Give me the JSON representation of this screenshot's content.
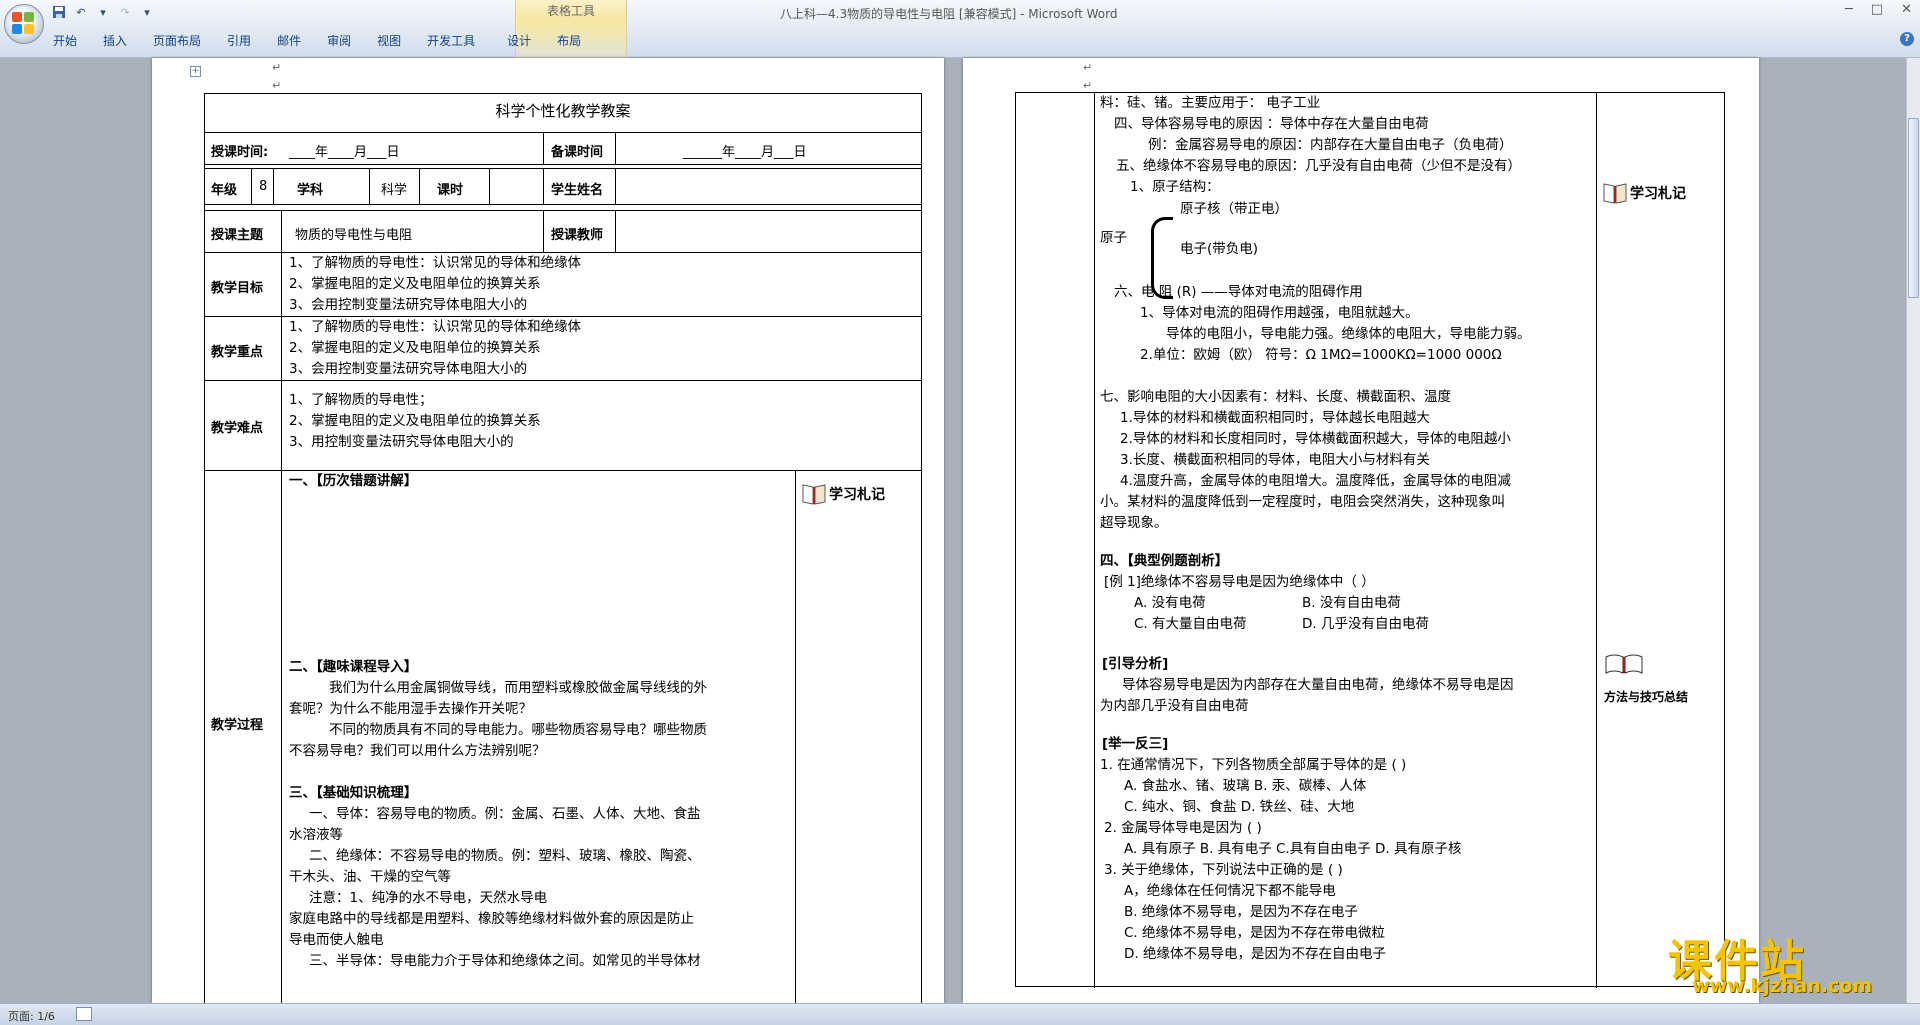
{
  "window": {
    "title": "八上科—4.3物质的导电性与电阻 [兼容模式] - Microsoft Word",
    "contextual_tab_group": "表格工具",
    "controls": [
      "─",
      "□",
      "✕"
    ]
  },
  "ribbon": {
    "tabs": [
      "开始",
      "插入",
      "页面布局",
      "引用",
      "邮件",
      "审阅",
      "视图",
      "开发工具",
      "设计",
      "布局"
    ]
  },
  "status": {
    "page": "页面: 1/6"
  },
  "page1": {
    "title": "科学个性化教学教案",
    "row1": {
      "label1": "授课时间:",
      "value1": "____年____月___日",
      "label2": "备课时间",
      "value2": "______年____月___日"
    },
    "row2": {
      "grade_label": "年级",
      "grade": "8",
      "subject_label": "学科",
      "subject": "科学",
      "period_label": "课时",
      "student_label": "学生姓名"
    },
    "row3": {
      "topic_label": "授课主题",
      "topic": "物质的导电性与电阻",
      "teacher_label": "授课教师"
    },
    "goals": {
      "label": "教学目标",
      "lines": [
        "1、了解物质的导电性：认识常见的导体和绝缘体",
        "2、掌握电阻的定义及电阻单位的换算关系",
        "3、会用控制变量法研究导体电阻大小的"
      ]
    },
    "key_points": {
      "label": "教学重点",
      "lines": [
        "1、了解物质的导电性：认识常见的导体和绝缘体",
        "2、掌握电阻的定义及电阻单位的换算关系",
        "3、会用控制变量法研究导体电阻大小的"
      ]
    },
    "difficulties": {
      "label": "教学难点",
      "lines": [
        "1、了解物质的导电性；",
        "2、掌握电阻的定义及电阻单位的换算关系",
        "3、用控制变量法研究导体电阻大小的"
      ]
    },
    "process": {
      "label": "教学过程",
      "section1": "一、【历次错题讲解】",
      "section2": "二、【趣味课程导入】",
      "intro_lines": [
        "我们为什么用金属铜做导线，而用塑料或橡胶做金属导线线的外",
        "套呢？为什么不能用湿手去操作开关呢？",
        "不同的物质具有不同的导电能力。哪些物质容易导电？哪些物质",
        "不容易导电？我们可以用什么方法辨别呢？"
      ],
      "section3": "三、【基础知识梳理】",
      "knowledge_lines": [
        "一、导体：容易导电的物质。例：金属、石墨、人体、大地、食盐",
        "水溶液等",
        "二、绝缘体：不容易导电的物质。例：塑料、玻璃、橡胶、陶瓷、",
        "干木头、油、干燥的空气等",
        "注意：1、纯净的水不导电，天然水导电",
        "家庭电路中的导线都是用塑料、橡胶等绝缘材料做外套的原因是防止",
        "导电而使人触电",
        "三、半导体：导电能力介于导体和绝缘体之间。如常见的半导体材"
      ]
    },
    "note_label": "学习札记"
  },
  "page2": {
    "top_lines": [
      "料：硅、锗。主要应用于： 电子工业",
      "四、导体容易导电的原因 ：导体中存在大量自由电荷",
      "例：金属容易导电的原因：内部存在大量自由电子（负电荷）",
      "五、绝缘体不容易导电的原因：几乎没有自由电荷（少但不是没有）",
      "1、原子结构："
    ],
    "atom": {
      "label": "原子",
      "nucleus": "原子核（带正电）",
      "electron": "电子(带负电)"
    },
    "resistance_lines": [
      "六、电 阻 (R) ——导体对电流的阻碍作用",
      "1、导体对电流的阻碍作用越强，电阻就越大。",
      "导体的电阻小，导电能力强。绝缘体的电阻大，导电能力弱。",
      "2.单位：欧姆（欧） 符号：Ω   1MΩ=1000KΩ=1000 000Ω"
    ],
    "factor_lines": [
      "七、影响电阻的大小因素有：材料、长度、横截面积、温度",
      "1.导体的材料和横截面积相同时，导体越长电阻越大",
      "2.导体的材料和长度相同时，导体横截面积越大，导体的电阻越小",
      "3.长度、横截面积相同的导体，电阻大小与材料有关",
      "4.温度升高，金属导体的电阻增大。温度降低，金属导体的电阻减",
      "小。某材料的温度降低到一定程度时，电阻会突然消失，这种现象叫",
      "超导现象。"
    ],
    "section4": "四、【典型例题剖析】",
    "example": {
      "question": "[例 1]绝缘体不容易导电是因为绝缘体中（    ）",
      "optA": "A. 没有电荷",
      "optB": "B. 没有自由电荷",
      "optC": "C. 有大量自由电荷",
      "optD": "D. 几乎没有自由电荷"
    },
    "analysis_title": "[引导分析]",
    "analysis_lines": [
      "导体容易导电是因为内部存在大量自由电荷，绝缘体不易导电是因",
      "为内部几乎没有自由电荷"
    ],
    "practice_title": "[举一反三]",
    "practice_lines": [
      "1. 在通常情况下，下列各物质全部属于导体的是      (        )",
      "A. 食盐水、锗、玻璃     B. 汞、碳棒、人体",
      "C. 纯水、铜、食盐      D. 铁丝、硅、大地",
      "2. 金属导体导电是因为     (        )",
      "A. 具有原子  B. 具有电子  C.具有自由电子   D. 具有原子核",
      "3. 关于绝缘体，下列说法中正确的是      (        )",
      "A，绝缘体在任何情况下都不能导电",
      "B. 绝缘体不易导电，是因为不存在电子",
      "C. 绝缘体不易导电，是因为不存在带电微粒",
      "D. 绝缘体不易导电，是因为不存在自由电子"
    ],
    "note_label": "学习札记",
    "method_label": "方法与技巧总结"
  },
  "watermark": {
    "main": "课件站",
    "url": "www.kjzhan.com"
  },
  "colors": {
    "ribbon_text": "#15428b",
    "contextual_tab": "#f6e7a3",
    "watermark": "#f5c400"
  }
}
